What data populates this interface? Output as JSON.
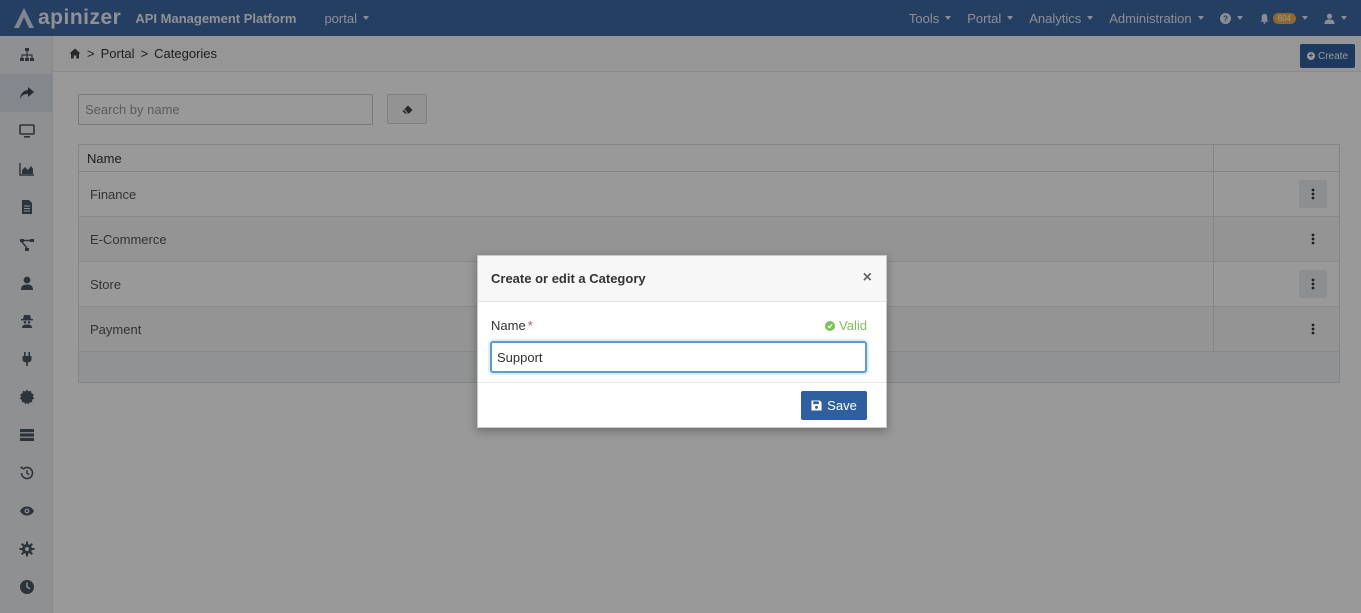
{
  "topbar": {
    "brand": "apinizer",
    "subtitle": "API Management Platform",
    "workspace": "portal",
    "menus": [
      "Tools",
      "Portal",
      "Analytics",
      "Administration"
    ],
    "notification_count": "604"
  },
  "sidebar": {
    "icons": [
      "sitemap-icon",
      "share-icon",
      "monitor-icon",
      "area-chart-icon",
      "document-icon",
      "topology-icon",
      "user-icon",
      "spy-icon",
      "plug-icon",
      "gear-badge-icon",
      "server-icon",
      "history-icon",
      "eye-icon",
      "cog-icon",
      "clock-icon"
    ],
    "active_index": 1
  },
  "breadcrumb": {
    "items": [
      "Portal",
      "Categories"
    ],
    "separator": ">"
  },
  "toolbar": {
    "create_label": "Create",
    "search_placeholder": "Search by name"
  },
  "table": {
    "header": "Name",
    "rows": [
      "Finance",
      "E-Commerce",
      "Store",
      "Payment"
    ]
  },
  "modal": {
    "title": "Create or edit a Category",
    "field_label": "Name",
    "required_mark": "*",
    "valid_text": "Valid",
    "input_value": "Support",
    "save_label": "Save"
  },
  "colors": {
    "navbar": "#3e6aa6",
    "primary_button": "#2f5f9e",
    "valid": "#7cc15a",
    "required": "#d9534f"
  }
}
